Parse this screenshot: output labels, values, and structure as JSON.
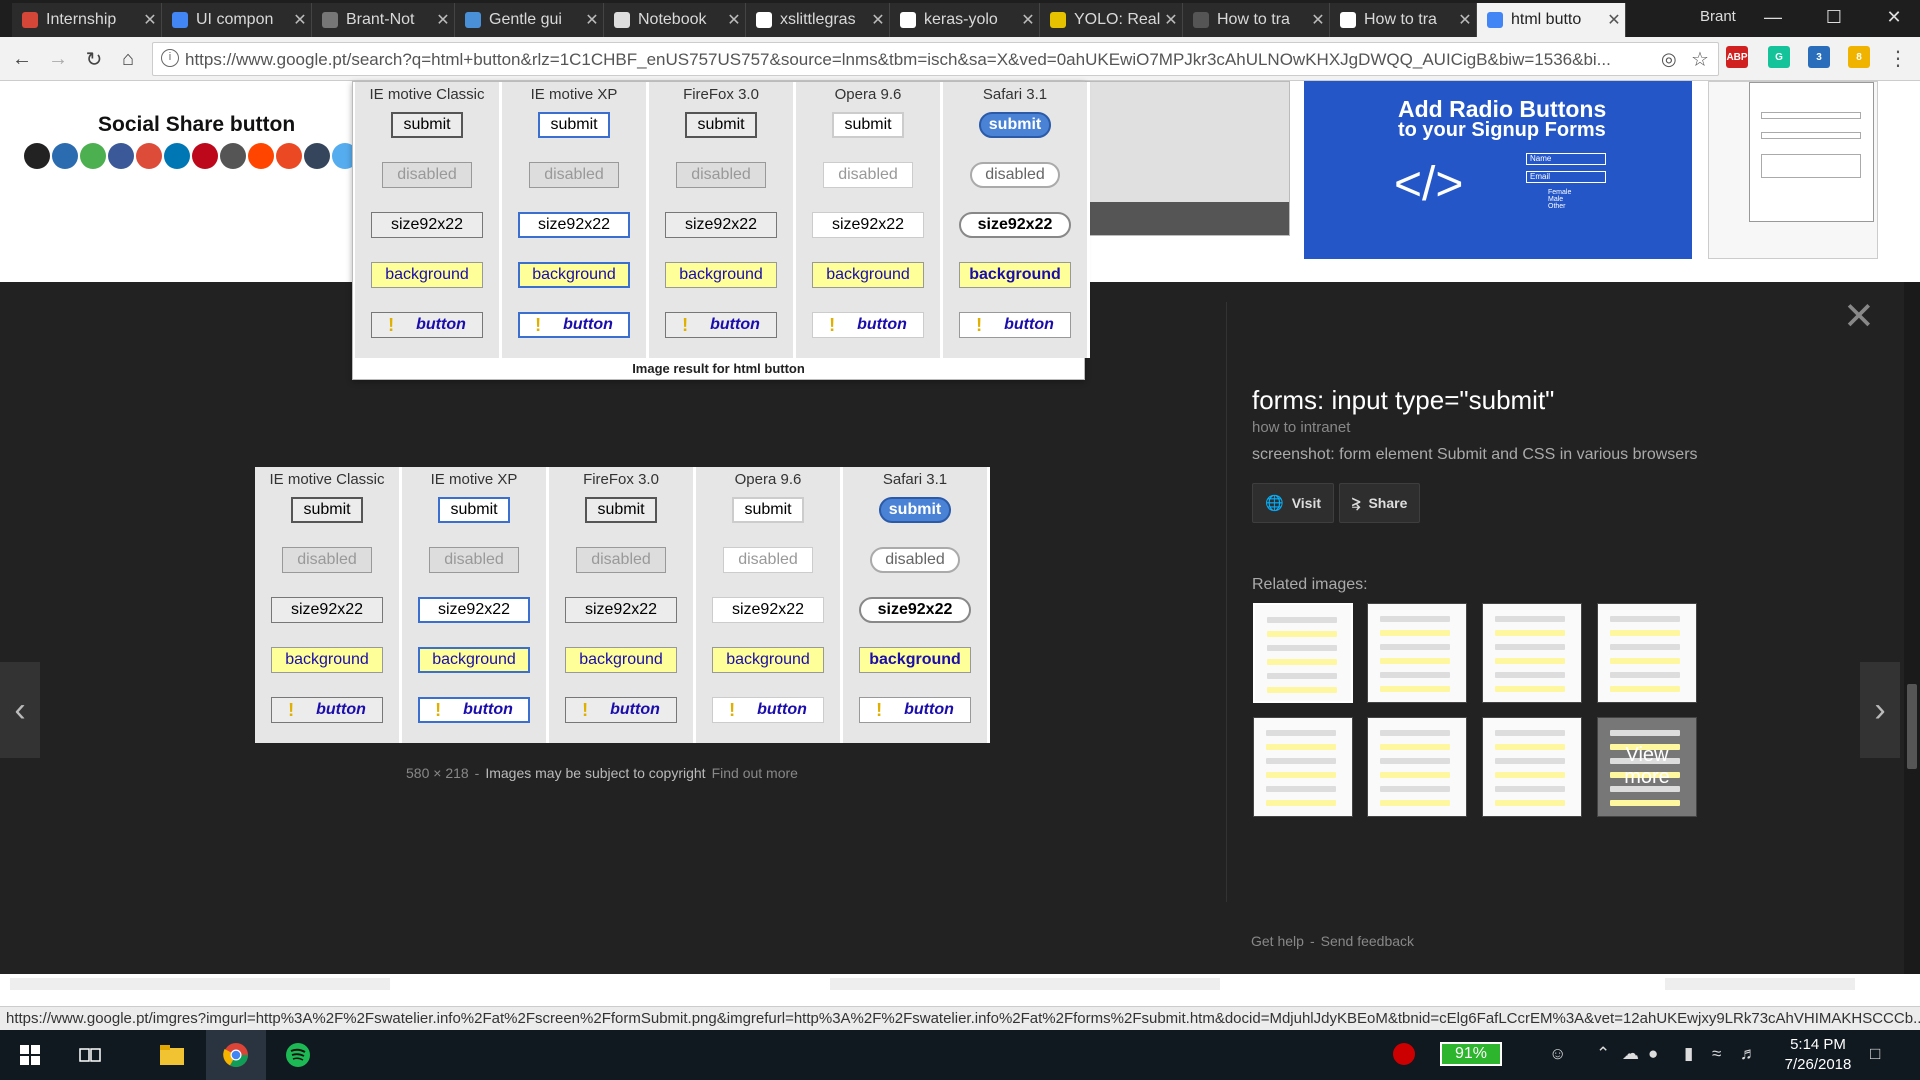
{
  "browser": {
    "tabs": [
      {
        "title": "Internship",
        "icon": "gmail-icon",
        "color": "#d44638"
      },
      {
        "title": "UI compon",
        "icon": "docs-icon",
        "color": "#4285f4"
      },
      {
        "title": "Brant-Not",
        "icon": "cog-site-icon",
        "color": "#777777"
      },
      {
        "title": "Gentle gui",
        "icon": "compass-site-icon",
        "color": "#4a90d9"
      },
      {
        "title": "Notebook",
        "icon": "page-icon",
        "color": "#dddddd"
      },
      {
        "title": "xslittlegras",
        "icon": "github-icon",
        "color": "#ffffff"
      },
      {
        "title": "keras-yolo",
        "icon": "github-icon",
        "color": "#ffffff"
      },
      {
        "title": "YOLO: Real",
        "icon": "pjreddie-icon",
        "color": "#e5c100"
      },
      {
        "title": "How to tra",
        "icon": "blank-icon",
        "color": "#555555"
      },
      {
        "title": "How to tra",
        "icon": "medium-icon",
        "color": "#ffffff"
      },
      {
        "title": "html butto",
        "icon": "google-icon",
        "color": "#4285f4",
        "active": true
      }
    ],
    "profile_name": "Brant",
    "url": "https://www.google.pt/search?q=html+button&rlz=1C1CHBF_enUS757US757&source=lnms&tbm=isch&sa=X&ved=0ahUKEwiO7MPJkr3cAhULNOwKHXJgDWQQ_AUICigB&biw=1536&bi...",
    "extensions": [
      "ABP",
      "G",
      "3",
      "8"
    ]
  },
  "background_results": {
    "social_title": "Social Share button",
    "add_radio_title": "Add Radio Buttons",
    "add_radio_sub": "to your Signup Forms",
    "radio_fields": [
      "Name",
      "Email",
      "Female",
      "Male",
      "Other"
    ]
  },
  "matrix": {
    "columns": [
      "IE motive Classic",
      "IE motive XP",
      "FireFox 3.0",
      "Opera 9.6",
      "Safari 3.1"
    ],
    "rows": [
      "submit",
      "disabled",
      "size92x22",
      "background",
      "button"
    ],
    "warn_glyph": "!",
    "hover_caption": "Image result for html button"
  },
  "preview": {
    "dimensions": "580 × 218",
    "separator": "-",
    "copyright": "Images may be subject to copyright",
    "find_out_more": "Find out more"
  },
  "info": {
    "title": "forms: input type=\"submit\"",
    "source": "how to intranet",
    "description": "screenshot: form element Submit and CSS in various browsers",
    "visit_label": "Visit",
    "share_label": "Share",
    "related_label": "Related images:",
    "view_more": "View more",
    "get_help": "Get help",
    "separator": "-",
    "send_feedback": "Send feedback"
  },
  "status_url": "https://www.google.pt/imgres?imgurl=http%3A%2F%2Fswatelier.info%2Fat%2Fscreen%2FformSubmit.png&imgrefurl=http%3A%2F%2Fswatelier.info%2Fat%2Fforms%2Fsubmit.htm&docid=MdjuhlJdyKBEoM&tbnid=cElg6FafLCcrEM%3A&vet=12ahUKEwjxy9LRk73cAhVHIMAKHSCCCb...",
  "taskbar": {
    "battery": "91%",
    "time": "5:14 PM",
    "date": "7/26/2018"
  },
  "colors": {
    "dark_panel": "#222222",
    "yellow_bg": "#ffff99",
    "link_blue": "#1a0dab",
    "safari_blue": "#4a82d6"
  }
}
